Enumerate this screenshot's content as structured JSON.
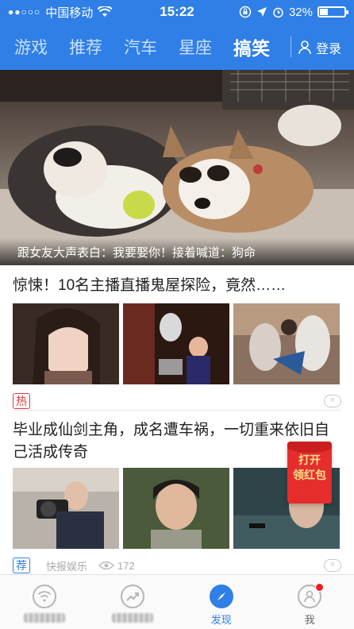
{
  "status_bar": {
    "carrier": "中国移动",
    "time": "15:22",
    "battery": "32%",
    "battery_level": 0.32
  },
  "tabs": [
    {
      "label": "游戏",
      "active": false
    },
    {
      "label": "推荐",
      "active": false
    },
    {
      "label": "汽车",
      "active": false
    },
    {
      "label": "星座",
      "active": false
    },
    {
      "label": "搞笑",
      "active": true
    }
  ],
  "login_label": "登录",
  "hero": {
    "caption": "跟女友大声表白：我要娶你！接着喊道：狗命"
  },
  "articles": [
    {
      "title": "惊悚！10名主播直播鬼屋探险，竟然……",
      "tag": "热",
      "close": "×"
    },
    {
      "title": "毕业成仙剑主角，成名遭车祸，一切重来依旧自己活成传奇",
      "tag": "荐",
      "source": "快报娱乐",
      "views": "172",
      "close": "×"
    }
  ],
  "red_packet": {
    "line1": "打开",
    "line2": "领红包"
  },
  "bottom_nav": [
    {
      "label": "",
      "icon": "wifi-icon"
    },
    {
      "label": "",
      "icon": "trend-icon"
    },
    {
      "label": "发现",
      "icon": "compass-icon",
      "active": true
    },
    {
      "label": "我",
      "icon": "user-icon",
      "badge": true
    }
  ],
  "colors": {
    "brand_blue": "#2f7fe6",
    "hot_red": "#e5383b",
    "red_packet": "#e52d2d"
  }
}
